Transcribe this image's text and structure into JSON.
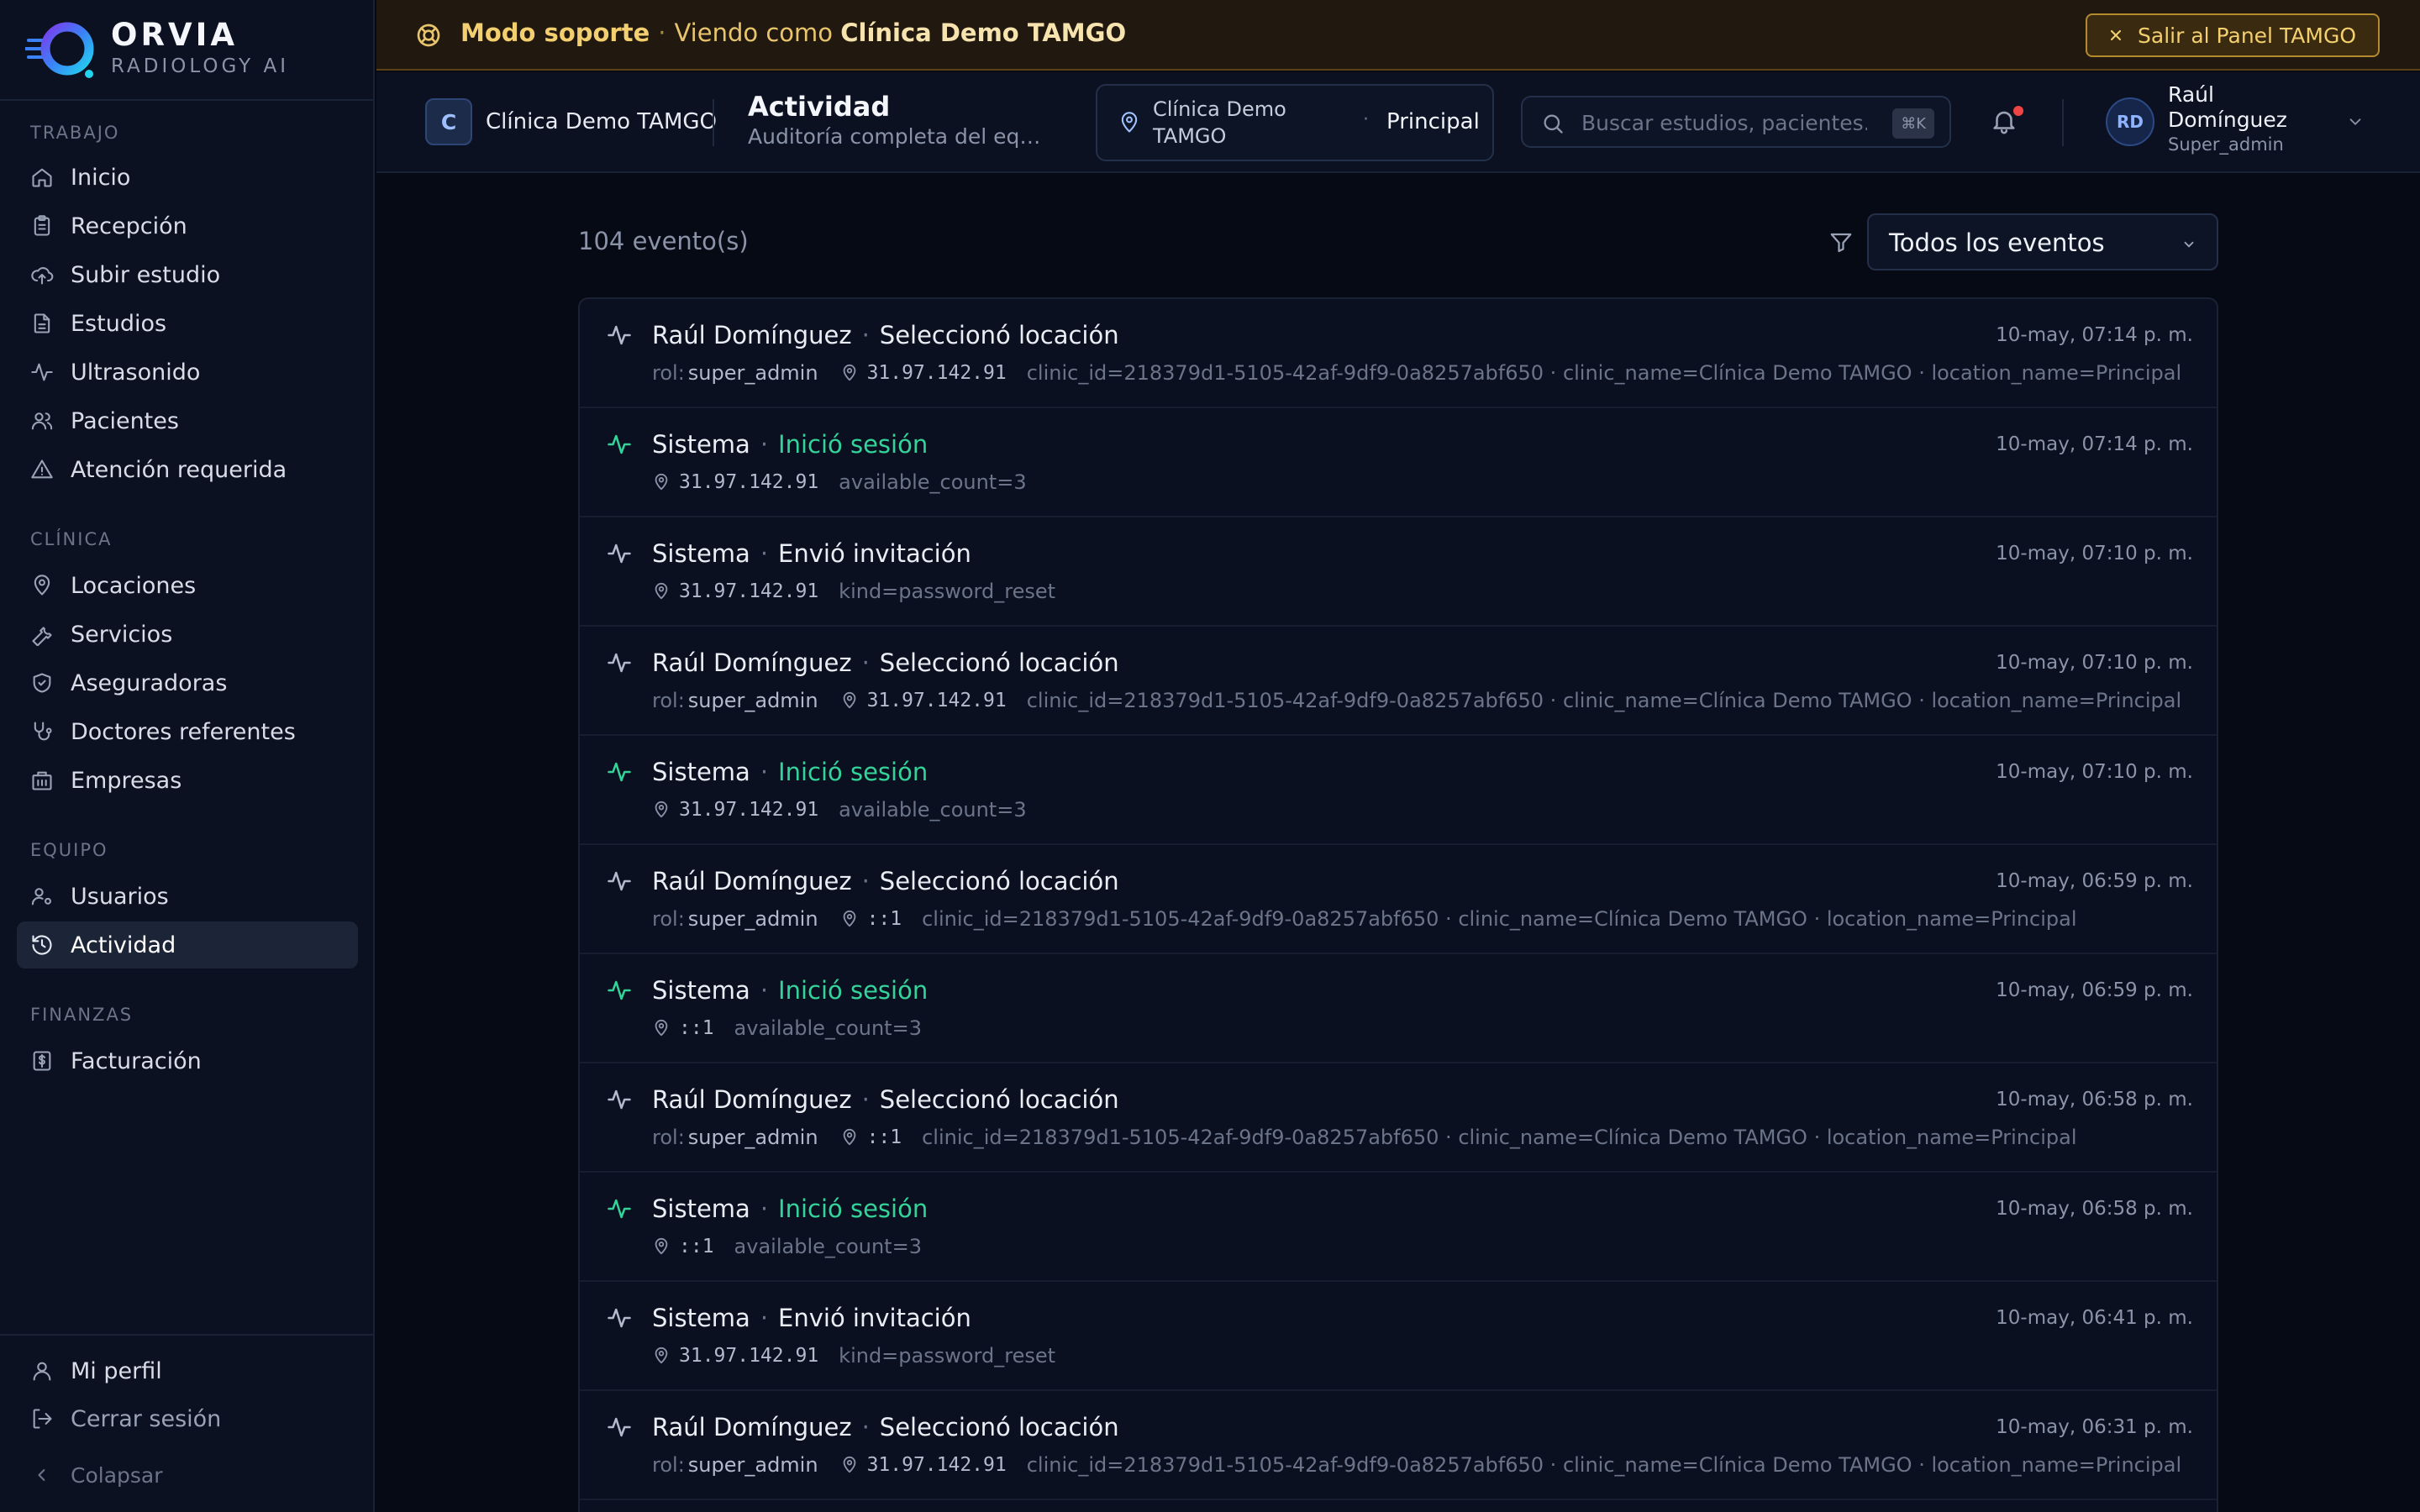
{
  "brand": {
    "name": "ORVIA",
    "subtitle": "RADIOLOGY AI"
  },
  "sidebar": {
    "sections": [
      {
        "title": "TRABAJO",
        "items": [
          "Inicio",
          "Recepción",
          "Subir estudio",
          "Estudios",
          "Ultrasonido",
          "Pacientes",
          "Atención requerida"
        ]
      },
      {
        "title": "CLÍNICA",
        "items": [
          "Locaciones",
          "Servicios",
          "Aseguradoras",
          "Doctores referentes",
          "Empresas"
        ]
      },
      {
        "title": "EQUIPO",
        "items": [
          "Usuarios",
          "Actividad"
        ]
      },
      {
        "title": "FINANZAS",
        "items": [
          "Facturación"
        ]
      }
    ],
    "active_item": "Actividad",
    "bottom": {
      "profile": "Mi perfil",
      "logout": "Cerrar sesión",
      "collapse": "Colapsar"
    }
  },
  "banner": {
    "mode": "Modo soporte",
    "viewing_prefix": "Viendo como",
    "viewing_clinic": "Clínica Demo TAMGO",
    "exit_label": "Salir al Panel TAMGO"
  },
  "header": {
    "clinic_initial": "C",
    "clinic_name": "Clínica Demo TAMGO",
    "title": "Actividad",
    "subtitle": "Auditoría completa del equ...",
    "location_clinic": "Clínica Demo TAMGO",
    "location_name": "Principal",
    "search_placeholder": "Buscar estudios, pacientes...",
    "search_shortcut": "⌘K",
    "user_initials": "RD",
    "user_name": "Raúl Domínguez",
    "user_role": "Super_admin"
  },
  "main": {
    "count": "104 evento(s)",
    "filter_value": "Todos los eventos"
  },
  "events": [
    {
      "actor": "Raúl Domínguez",
      "action": "Seleccionó locación",
      "success": false,
      "time": "10-may, 07:14 p. m.",
      "role_label": "rol:",
      "role": "super_admin",
      "ip": "31.97.142.91",
      "details": "clinic_id=218379d1-5105-42af-9df9-0a8257abf650 · clinic_name=Clínica Demo TAMGO · location_name=Principal"
    },
    {
      "actor": "Sistema",
      "action": "Inició sesión",
      "success": true,
      "time": "10-may, 07:14 p. m.",
      "role_label": "",
      "role": "",
      "ip": "31.97.142.91",
      "details": "available_count=3"
    },
    {
      "actor": "Sistema",
      "action": "Envió invitación",
      "success": false,
      "time": "10-may, 07:10 p. m.",
      "role_label": "",
      "role": "",
      "ip": "31.97.142.91",
      "details": "kind=password_reset"
    },
    {
      "actor": "Raúl Domínguez",
      "action": "Seleccionó locación",
      "success": false,
      "time": "10-may, 07:10 p. m.",
      "role_label": "rol:",
      "role": "super_admin",
      "ip": "31.97.142.91",
      "details": "clinic_id=218379d1-5105-42af-9df9-0a8257abf650 · clinic_name=Clínica Demo TAMGO · location_name=Principal"
    },
    {
      "actor": "Sistema",
      "action": "Inició sesión",
      "success": true,
      "time": "10-may, 07:10 p. m.",
      "role_label": "",
      "role": "",
      "ip": "31.97.142.91",
      "details": "available_count=3"
    },
    {
      "actor": "Raúl Domínguez",
      "action": "Seleccionó locación",
      "success": false,
      "time": "10-may, 06:59 p. m.",
      "role_label": "rol:",
      "role": "super_admin",
      "ip": "::1",
      "details": "clinic_id=218379d1-5105-42af-9df9-0a8257abf650 · clinic_name=Clínica Demo TAMGO · location_name=Principal"
    },
    {
      "actor": "Sistema",
      "action": "Inició sesión",
      "success": true,
      "time": "10-may, 06:59 p. m.",
      "role_label": "",
      "role": "",
      "ip": "::1",
      "details": "available_count=3"
    },
    {
      "actor": "Raúl Domínguez",
      "action": "Seleccionó locación",
      "success": false,
      "time": "10-may, 06:58 p. m.",
      "role_label": "rol:",
      "role": "super_admin",
      "ip": "::1",
      "details": "clinic_id=218379d1-5105-42af-9df9-0a8257abf650 · clinic_name=Clínica Demo TAMGO · location_name=Principal"
    },
    {
      "actor": "Sistema",
      "action": "Inició sesión",
      "success": true,
      "time": "10-may, 06:58 p. m.",
      "role_label": "",
      "role": "",
      "ip": "::1",
      "details": "available_count=3"
    },
    {
      "actor": "Sistema",
      "action": "Envió invitación",
      "success": false,
      "time": "10-may, 06:41 p. m.",
      "role_label": "",
      "role": "",
      "ip": "31.97.142.91",
      "details": "kind=password_reset"
    },
    {
      "actor": "Raúl Domínguez",
      "action": "Seleccionó locación",
      "success": false,
      "time": "10-may, 06:31 p. m.",
      "role_label": "rol:",
      "role": "super_admin",
      "ip": "31.97.142.91",
      "details": "clinic_id=218379d1-5105-42af-9df9-0a8257abf650 · clinic_name=Clínica Demo TAMGO · location_name=Principal"
    }
  ],
  "colors": {
    "accent_gold": "#f3cf6f",
    "success_green": "#34d399",
    "background": "#060a14",
    "sidebar": "#0b1120"
  }
}
